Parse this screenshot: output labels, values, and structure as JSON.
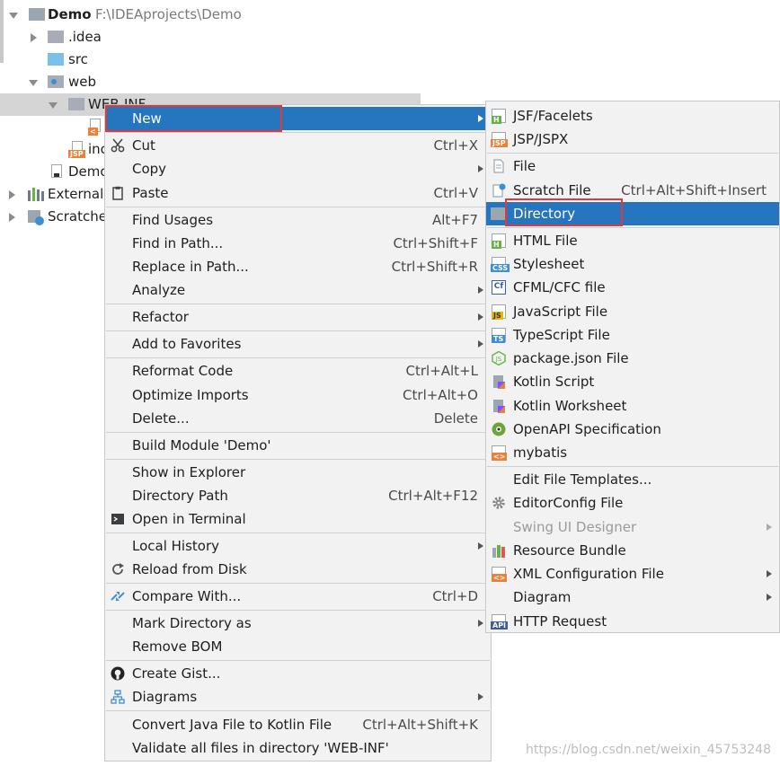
{
  "tree": {
    "root_name": "Demo",
    "root_path": "F:\\IDEAprojects\\Demo",
    "items": {
      "idea": ".idea",
      "src": "src",
      "web": "web",
      "webinf": "WEB-INF",
      "index": "inc",
      "demo_iml": "Demo",
      "external": "External",
      "scratches": "Scratche"
    }
  },
  "context_menu": {
    "new": "New",
    "cut": "Cut",
    "cut_sc": "Ctrl+X",
    "copy": "Copy",
    "paste": "Paste",
    "paste_sc": "Ctrl+V",
    "find_usages": "Find Usages",
    "find_usages_sc": "Alt+F7",
    "find_in_path": "Find in Path...",
    "find_in_path_sc": "Ctrl+Shift+F",
    "replace_in_path": "Replace in Path...",
    "replace_in_path_sc": "Ctrl+Shift+R",
    "analyze": "Analyze",
    "refactor": "Refactor",
    "add_to_favorites": "Add to Favorites",
    "reformat_code": "Reformat Code",
    "reformat_code_sc": "Ctrl+Alt+L",
    "optimize_imports": "Optimize Imports",
    "optimize_imports_sc": "Ctrl+Alt+O",
    "delete": "Delete...",
    "delete_sc": "Delete",
    "build_module": "Build Module 'Demo'",
    "show_in_explorer": "Show in Explorer",
    "directory_path": "Directory Path",
    "directory_path_sc": "Ctrl+Alt+F12",
    "open_in_terminal": "Open in Terminal",
    "local_history": "Local History",
    "reload_from_disk": "Reload from Disk",
    "compare_with": "Compare With...",
    "compare_with_sc": "Ctrl+D",
    "mark_directory_as": "Mark Directory as",
    "remove_bom": "Remove BOM",
    "create_gist": "Create Gist...",
    "diagrams": "Diagrams",
    "convert_java_kotlin": "Convert Java File to Kotlin File",
    "convert_java_kotlin_sc": "Ctrl+Alt+Shift+K",
    "validate_all": "Validate all files in directory 'WEB-INF'"
  },
  "new_submenu": {
    "jsf": "JSF/Facelets",
    "jsp": "JSP/JSPX",
    "file": "File",
    "scratch_file": "Scratch File",
    "scratch_file_sc": "Ctrl+Alt+Shift+Insert",
    "directory": "Directory",
    "html_file": "HTML File",
    "stylesheet": "Stylesheet",
    "cfml": "CFML/CFC file",
    "javascript": "JavaScript File",
    "typescript": "TypeScript File",
    "package_json": "package.json File",
    "kotlin_script": "Kotlin Script",
    "kotlin_worksheet": "Kotlin Worksheet",
    "openapi": "OpenAPI Specification",
    "mybatis": "mybatis",
    "edit_templates": "Edit File Templates...",
    "editorconfig": "EditorConfig File",
    "swing_ui": "Swing UI Designer",
    "resource_bundle": "Resource Bundle",
    "xml_config": "XML Configuration File",
    "diagram": "Diagram",
    "http_request": "HTTP Request"
  },
  "watermark": "https://blog.csdn.net/weixin_45753248",
  "colors": {
    "highlight": "#2675bf",
    "annotation": "#e0393c",
    "menu_bg": "#f2f2f2"
  }
}
